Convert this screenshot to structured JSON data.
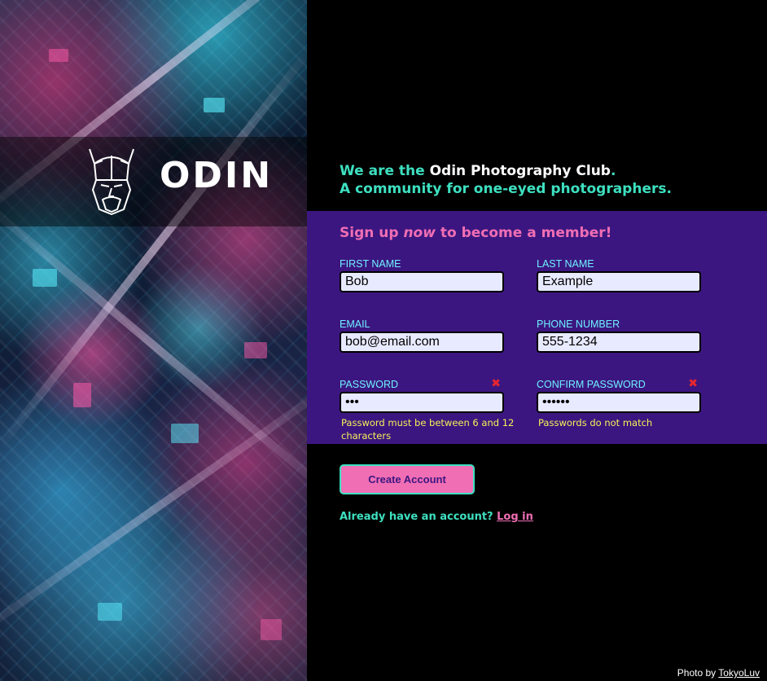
{
  "brand": {
    "logo_text": "ODIN",
    "logo_icon": "viking-helmet-icon",
    "photo_credit_prefix": "Photo by",
    "photo_credit_link": "TokyoLuv"
  },
  "intro": {
    "line1_prefix": "We are the ",
    "line1_club": "Odin Photography Club",
    "line1_suffix": ".",
    "line2": "A community for one-eyed photographers."
  },
  "signup": {
    "title_prefix": "Sign up ",
    "title_emphasis": "now",
    "title_suffix": " to become a member!"
  },
  "fields": {
    "first_name": {
      "label": "First Name",
      "value": "Bob"
    },
    "last_name": {
      "label": "Last Name",
      "value": "Example"
    },
    "email": {
      "label": "Email",
      "value": "bob@email.com"
    },
    "phone": {
      "label": "Phone Number",
      "value": "555-1234"
    },
    "password": {
      "label": "Password",
      "value": "abc",
      "error_icon": "✖",
      "error": "Password must be between 6 and 12 characters"
    },
    "confirm_password": {
      "label": "Confirm Password",
      "value": "abcdef",
      "error_icon": "✖",
      "error": "Passwords do not match"
    }
  },
  "actions": {
    "create_button": "Create Account",
    "login_prompt": "Already have an account?",
    "login_link": "Log in"
  },
  "colors": {
    "accent_teal": "#3de0c0",
    "accent_pink": "#f06eb4",
    "panel_purple": "#3c1680",
    "label_cyan": "#6ef0ff",
    "error_yellow": "#f6f05a",
    "error_red": "#e8262e"
  }
}
